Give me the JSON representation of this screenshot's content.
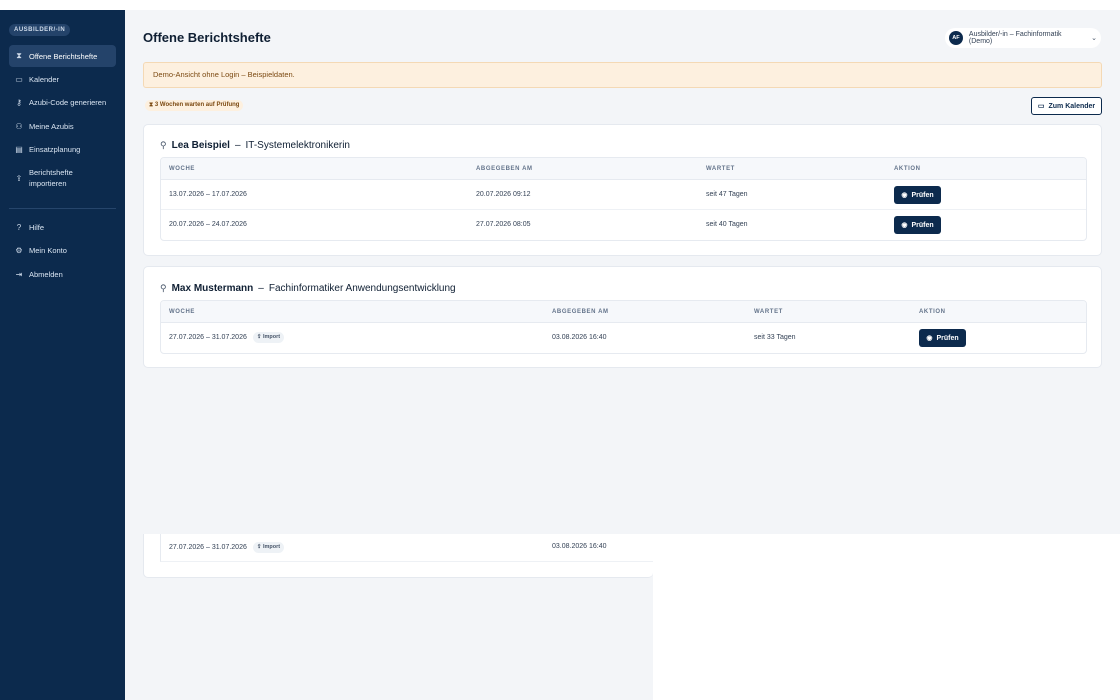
{
  "sidebar": {
    "role_badge": "AUSBILDER/-IN",
    "items": [
      {
        "label": "Offene Berichtshefte",
        "icon": "hourglass-icon"
      },
      {
        "label": "Kalender",
        "icon": "calendar-icon"
      },
      {
        "label": "Azubi-Code generieren",
        "icon": "key-icon"
      },
      {
        "label": "Meine Azubis",
        "icon": "users-icon"
      },
      {
        "label": "Einsatzplanung",
        "icon": "clipboard-icon"
      },
      {
        "label_line1": "Berichtshefte",
        "label_line2": "importieren",
        "icon": "upload-icon"
      }
    ],
    "bottom_items": [
      {
        "label": "Hilfe",
        "icon": "help-icon"
      },
      {
        "label": "Mein Konto",
        "icon": "gear-icon"
      },
      {
        "label": "Abmelden",
        "icon": "logout-icon"
      }
    ]
  },
  "header": {
    "title": "Offene Berichtshefte",
    "account_initials": "AF",
    "account_name": "Ausbilder/-in – Fachinformatik (Demo)"
  },
  "notice": "Demo-Ansicht ohne Login – Beispieldaten.",
  "wait_badge": "3 Wochen warten auf Prüfung",
  "calendar_button": "Zum Kalender",
  "columns": {
    "woche": "WOCHE",
    "abgegeben": "ABGEGEBEN AM",
    "wartet": "WARTET",
    "aktion": "AKTION"
  },
  "action_label": "Prüfen",
  "import_label": "Import",
  "cards": [
    {
      "name": "Lea Beispiel",
      "separator": "–",
      "profession": "IT-Systemelektronikerin",
      "rows": [
        {
          "woche": "13.07.2026 – 17.07.2026",
          "abgegeben": "20.07.2026 09:12",
          "wartet": "seit 47 Tagen"
        },
        {
          "woche": "20.07.2026 – 24.07.2026",
          "abgegeben": "27.07.2026 08:05",
          "wartet": "seit 40 Tagen"
        }
      ]
    },
    {
      "name": "Max Mustermann",
      "separator": "–",
      "profession": "Fachinformatiker Anwendungsentwicklung",
      "rows": [
        {
          "woche": "27.07.2026 – 31.07.2026",
          "import": true,
          "abgegeben": "03.08.2026 16:40",
          "wartet": "seit 33 Tagen"
        }
      ]
    }
  ],
  "ghost_row": {
    "woche": "27.07.2026 – 31.07.2026",
    "abgegeben": "03.08.2026 16:40"
  }
}
